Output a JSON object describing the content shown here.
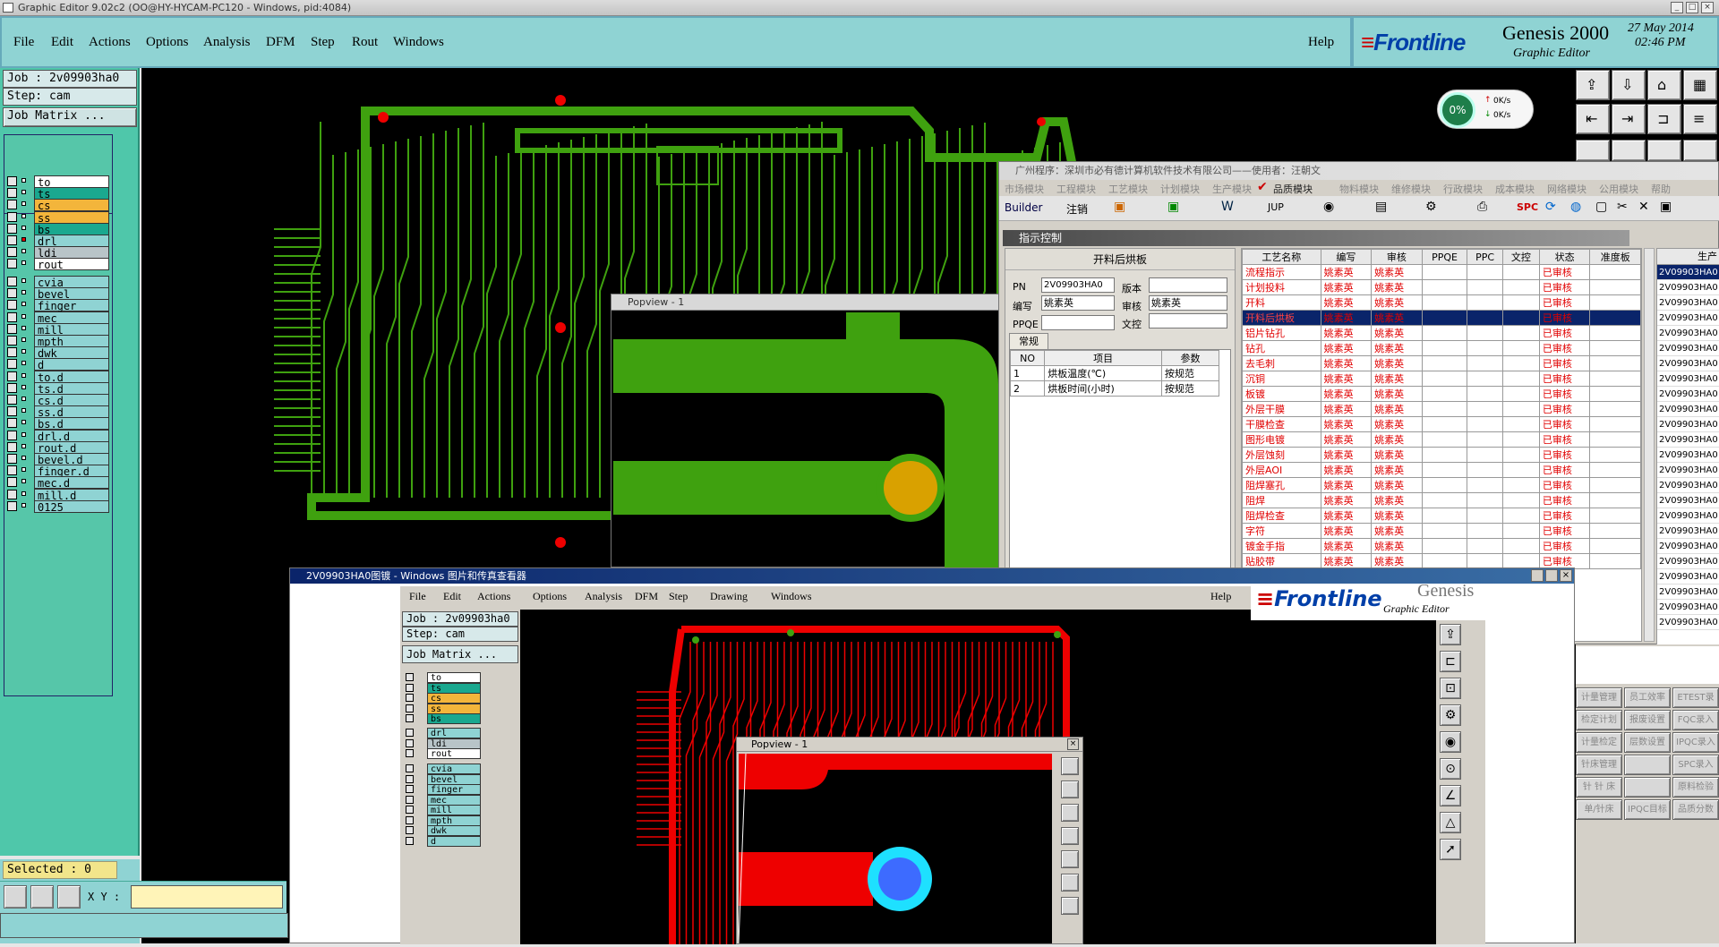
{
  "window": {
    "title": "Graphic Editor 9.02c2 (OO@HY-HYCAM-PC120 - Windows, pid:4084)"
  },
  "menu": [
    "File",
    "Edit",
    "Actions",
    "Options",
    "Analysis",
    "DFM",
    "Step",
    "Rout",
    "Windows"
  ],
  "help": "Help",
  "brand": {
    "logo": "Frontline",
    "product": "Genesis 2000",
    "subtitle": "Graphic Editor",
    "date": "27 May 2014",
    "time": "02:46 PM"
  },
  "net": {
    "percent": "0%",
    "up": "0K/s",
    "down": "0K/s"
  },
  "job": {
    "job": "Job : 2v09903ha0",
    "step": "Step: cam",
    "matrix": "Job Matrix ..."
  },
  "layers1": [
    "to",
    "ts",
    "cs",
    "ss",
    "bs"
  ],
  "layers2": [
    "drl",
    "ldi",
    "rout"
  ],
  "layers3": [
    "cvia",
    "bevel",
    "finger",
    "mec",
    "mill",
    "mpth",
    "dwk",
    "d",
    "to.d",
    "ts.d",
    "cs.d",
    "ss.d",
    "bs.d",
    "drl.d",
    "rout.d",
    "bevel.d",
    "finger.d",
    "mec.d",
    "mill.d",
    "0125"
  ],
  "status": {
    "selected": "Selected : 0",
    "xy": "X Y :"
  },
  "popview": {
    "title": "Popview - 1"
  },
  "erp": {
    "title": "广州程序：深圳市必有德计算机软件技术有限公司——使用者：汪朝文",
    "menu": [
      "市场模块",
      "工程模块",
      "工艺模块",
      "计划模块",
      "生产模块",
      "品质模块",
      "物料模块",
      "维修模块",
      "行政模块",
      "成本模块",
      "网络模块",
      "公用模块",
      "帮助"
    ],
    "toolbar": {
      "builder": "Builder",
      "logout": "注销",
      "jup": "JUP",
      "spc": "SPC"
    },
    "panel_title": "指示控制",
    "form_title": "开料后烘板",
    "pn_label": "PN",
    "pn": "2V09903HA0",
    "version_label": "版本",
    "version": "",
    "author_label": "编写",
    "author": "姚素英",
    "review_label": "审核",
    "reviewer": "姚素英",
    "ppqe_label": "PPQE",
    "ppqe": "",
    "doc_label": "文控",
    "doc": "",
    "tab": "常规",
    "param_headers": [
      "NO",
      "项目",
      "参数"
    ],
    "params": [
      [
        "1",
        "烘板温度(℃)",
        "按规范"
      ],
      [
        "2",
        "烘板时间(小时)",
        "按规范"
      ]
    ],
    "headers": [
      "工艺名称",
      "编写",
      "审核",
      "PPQE",
      "PPC",
      "文控",
      "状态",
      "准度板"
    ],
    "rows": [
      "流程指示",
      "计划投料",
      "开料",
      "开料后烘板",
      "铝片钻孔",
      "钻孔",
      "去毛刺",
      "沉铜",
      "板镀",
      "外层干膜",
      "干膜检查",
      "图形电镀",
      "外层蚀刻",
      "外层AOI",
      "阻焊塞孔",
      "阻焊",
      "阻焊检查",
      "字符",
      "镀金手指",
      "贴胶带"
    ],
    "writer": "姚素英",
    "reviewer_col": "姚素英",
    "state": "已审核",
    "right_header": "生产",
    "right_val": "2V09903HA0",
    "buttons": [
      [
        "计量管理",
        "员工效率",
        "ETEST录入"
      ],
      [
        "检定计划",
        "报废设置",
        "FQC录入"
      ],
      [
        "计量检定",
        "层数设置",
        "IPQC录入"
      ],
      [
        "针床管理",
        "",
        "SPC录入"
      ],
      [
        "针 针 床",
        "",
        "原料检验"
      ],
      [
        "单/针床",
        "IPQC目标",
        "品质分数"
      ]
    ]
  },
  "viewer": {
    "title": "2V09903HA0图镀 - Windows 图片和传真查看器",
    "menu": [
      "File",
      "Edit",
      "Actions",
      "Options",
      "Analysis",
      "DFM",
      "Step",
      "Drawing",
      "Windows"
    ],
    "help": "Help",
    "logo": "Frontline",
    "product": "Genesis",
    "subtitle": "Graphic Editor",
    "job": "Job : 2v09903ha0",
    "step": "Step: cam",
    "matrix": "Job Matrix ...",
    "layers1": [
      "to",
      "ts",
      "cs",
      "ss",
      "bs"
    ],
    "layers2": [
      "drl",
      "ldi",
      "rout"
    ],
    "layers3": [
      "cvia",
      "bevel",
      "finger",
      "mec",
      "mill",
      "mpth",
      "dwk",
      "d"
    ],
    "popview": "Popview - 1"
  }
}
